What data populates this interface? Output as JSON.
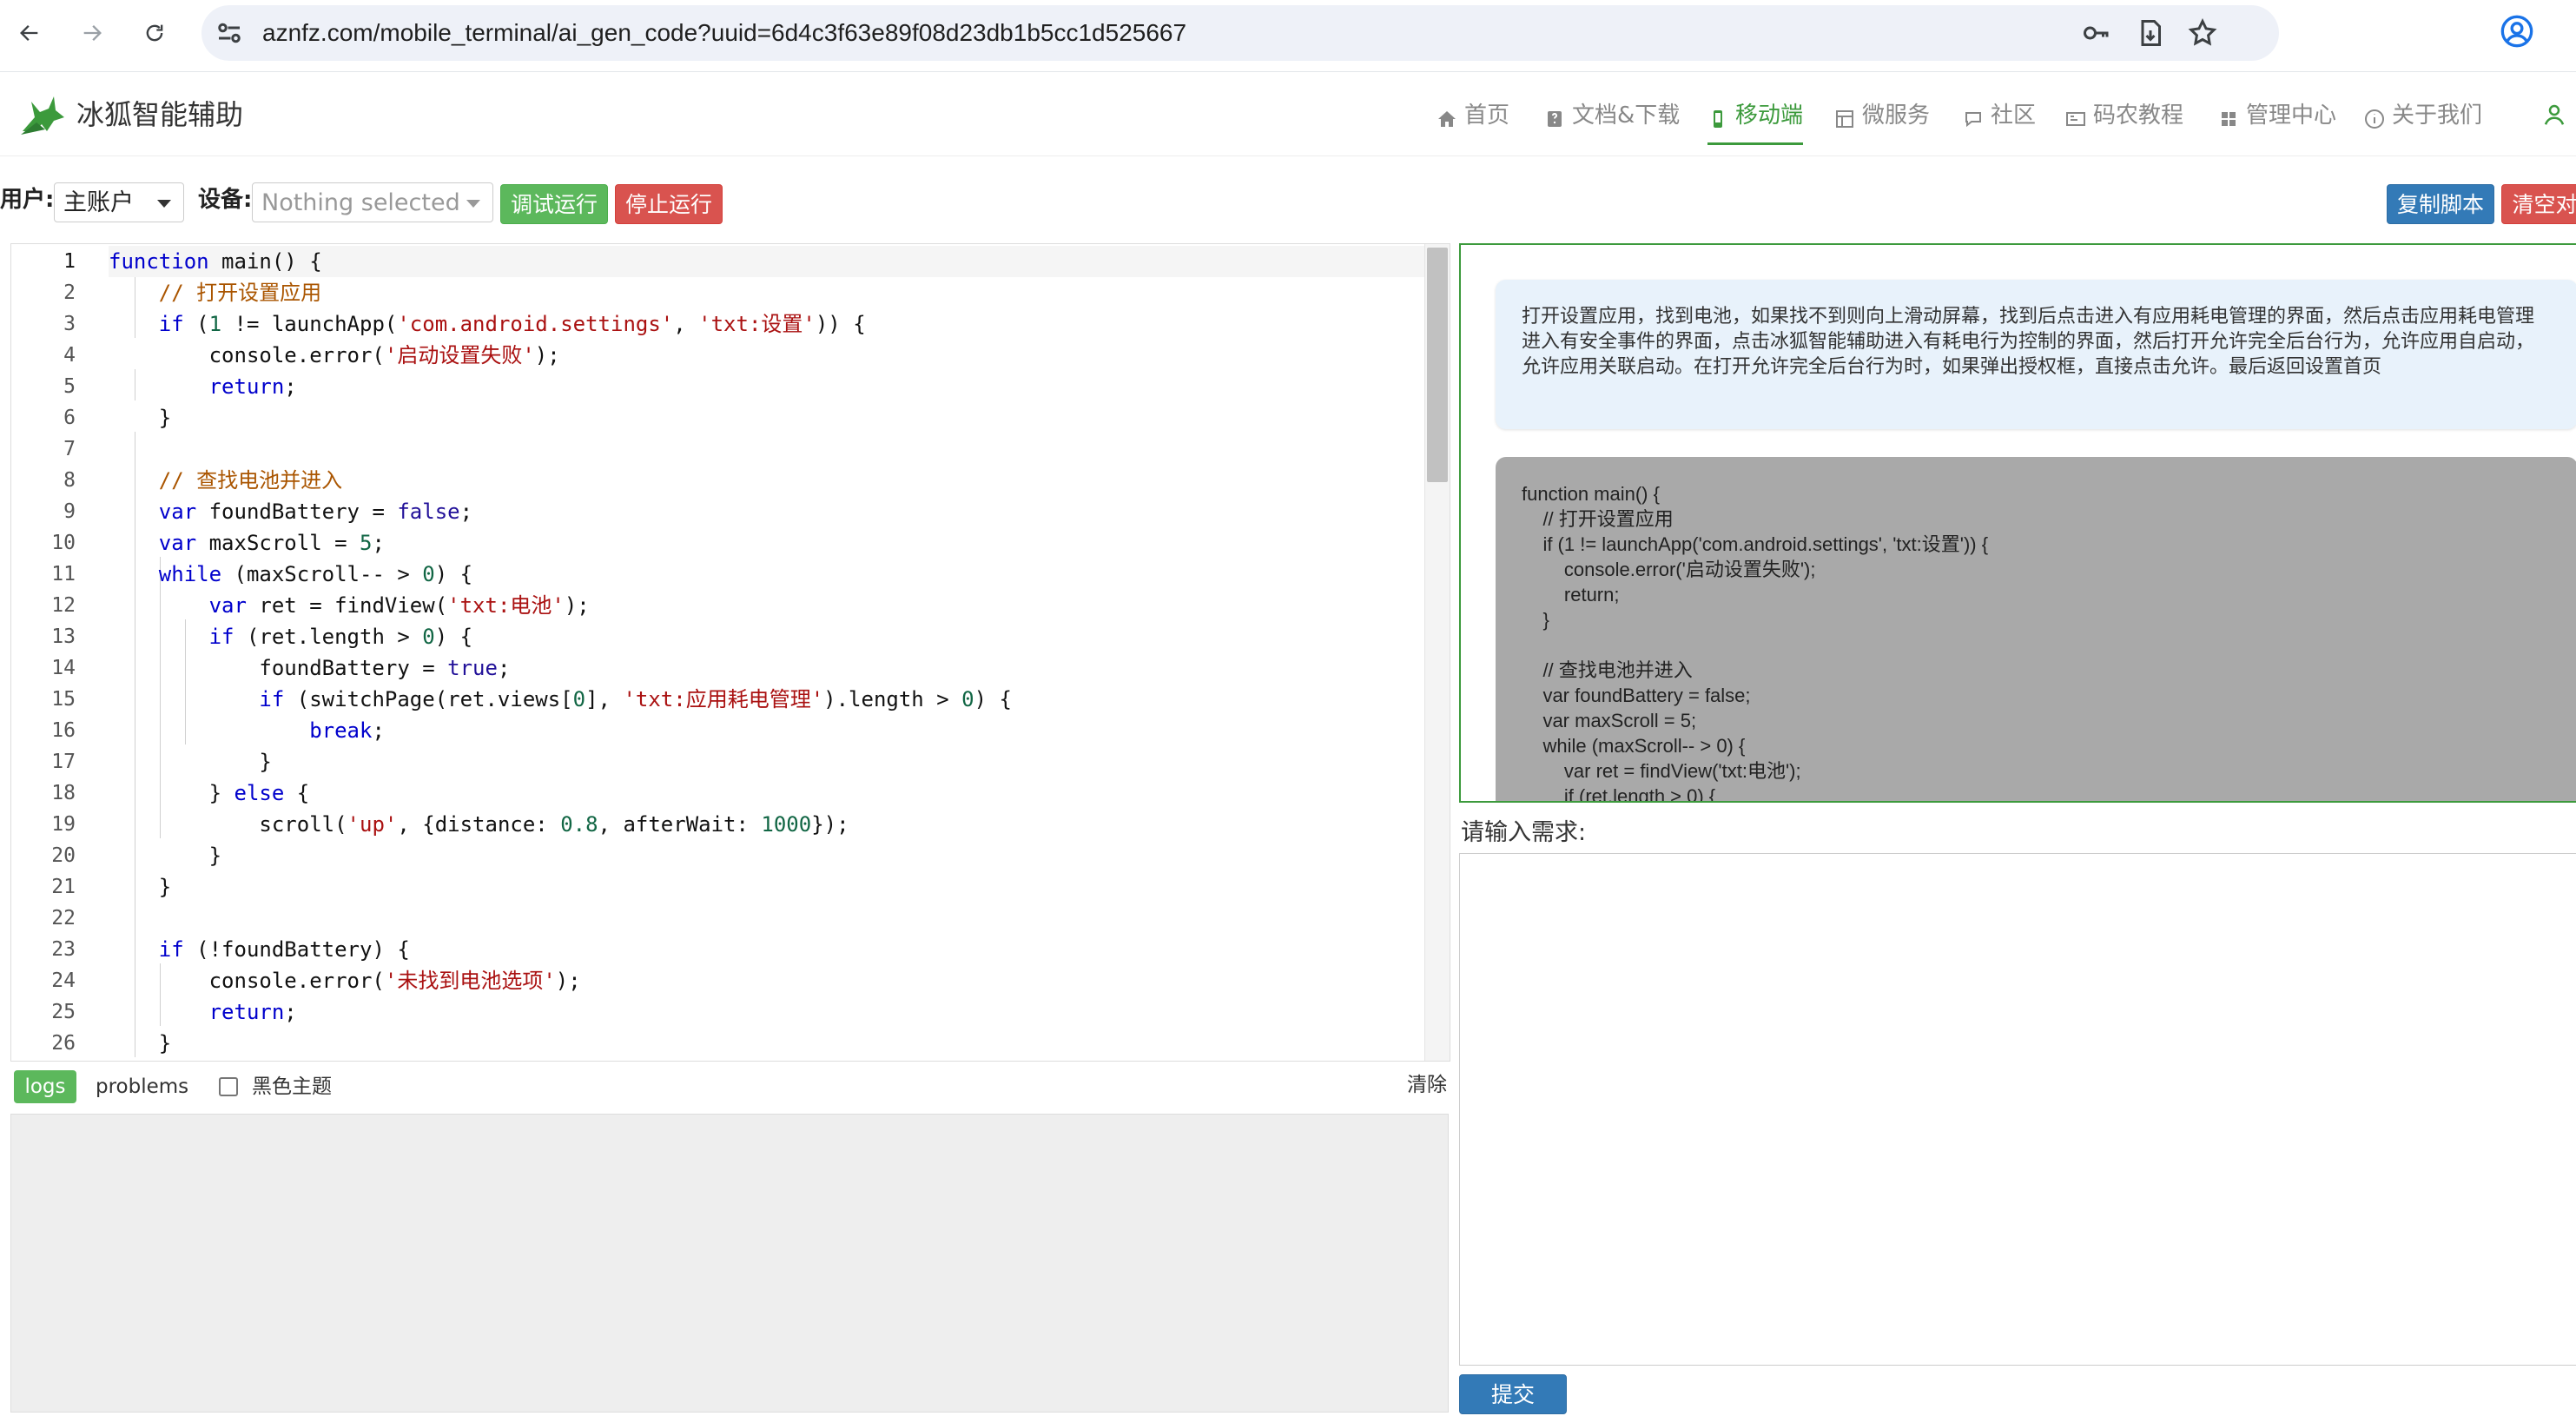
{
  "browser": {
    "url_host": "aznfz.com",
    "url_path": "/mobile_terminal/ai_gen_code?uuid=6d4c3f63e89f08d23db1b5cc1d525667"
  },
  "site": {
    "brand": "冰狐智能辅助",
    "menu": [
      {
        "label": "首页",
        "icon": "home-icon"
      },
      {
        "label": "文档&下载",
        "icon": "document-icon"
      },
      {
        "label": "移动端",
        "icon": "mobile-icon",
        "active": true
      },
      {
        "label": "微服务",
        "icon": "microservice-icon"
      },
      {
        "label": "社区",
        "icon": "chat-icon"
      },
      {
        "label": "码农教程",
        "icon": "tutorial-icon"
      },
      {
        "label": "管理中心",
        "icon": "grid-icon"
      },
      {
        "label": "关于我们",
        "icon": "info-icon"
      }
    ],
    "accent_color": "#3c9a3c"
  },
  "toolbar": {
    "user_label": "用户:",
    "user_value": "主账户",
    "device_label": "设备:",
    "device_value": "Nothing selected",
    "run_label": "调试运行",
    "stop_label": "停止运行",
    "copy_label": "复制脚本",
    "clear_label": "清空对"
  },
  "editor": {
    "line_numbers": [
      "1",
      "2",
      "3",
      "4",
      "5",
      "6",
      "7",
      "8",
      "9",
      "10",
      "11",
      "12",
      "13",
      "14",
      "15",
      "16",
      "17",
      "18",
      "19",
      "20",
      "21",
      "22",
      "23",
      "24",
      "25",
      "26"
    ],
    "lines": [
      "function main() {",
      "    // 打开设置应用",
      "    if (1 != launchApp('com.android.settings', 'txt:设置')) {",
      "        console.error('启动设置失败');",
      "        return;",
      "    }",
      "",
      "    // 查找电池并进入",
      "    var foundBattery = false;",
      "    var maxScroll = 5;",
      "    while (maxScroll-- > 0) {",
      "        var ret = findView('txt:电池');",
      "        if (ret.length > 0) {",
      "            foundBattery = true;",
      "            if (switchPage(ret.views[0], 'txt:应用耗电管理').length > 0) {",
      "                break;",
      "            }",
      "        } else {",
      "            scroll('up', {distance: 0.8, afterWait: 1000});",
      "        }",
      "    }",
      "",
      "    if (!foundBattery) {",
      "        console.error('未找到电池选项');",
      "        return;",
      "    }"
    ]
  },
  "logs": {
    "tab_logs": "logs",
    "tab_problems": "problems",
    "dark_theme_label": "黑色主题",
    "clear_label": "清除"
  },
  "chat": {
    "user_message": "打开设置应用，找到电池，如果找不到则向上滑动屏幕，找到后点击进入有应用耗电管理的界面，然后点击应用耗电管理进入有安全事件的界面，点击冰狐智能辅助进入有耗电行为控制的界面，然后打开允许完全后台行为，允许应用自启动，允许应用关联启动。在打开允许完全后台行为时，如果弹出授权框，直接点击允许。最后返回设置首页",
    "code_reply": "function main() {\n    // 打开设置应用\n    if (1 != launchApp('com.android.settings', 'txt:设置')) {\n        console.error('启动设置失败');\n        return;\n    }\n\n    // 查找电池并进入\n    var foundBattery = false;\n    var maxScroll = 5;\n    while (maxScroll-- > 0) {\n        var ret = findView('txt:电池');\n        if (ret.length > 0) {"
  },
  "request": {
    "label": "请输入需求:",
    "value": "",
    "submit_label": "提交"
  }
}
